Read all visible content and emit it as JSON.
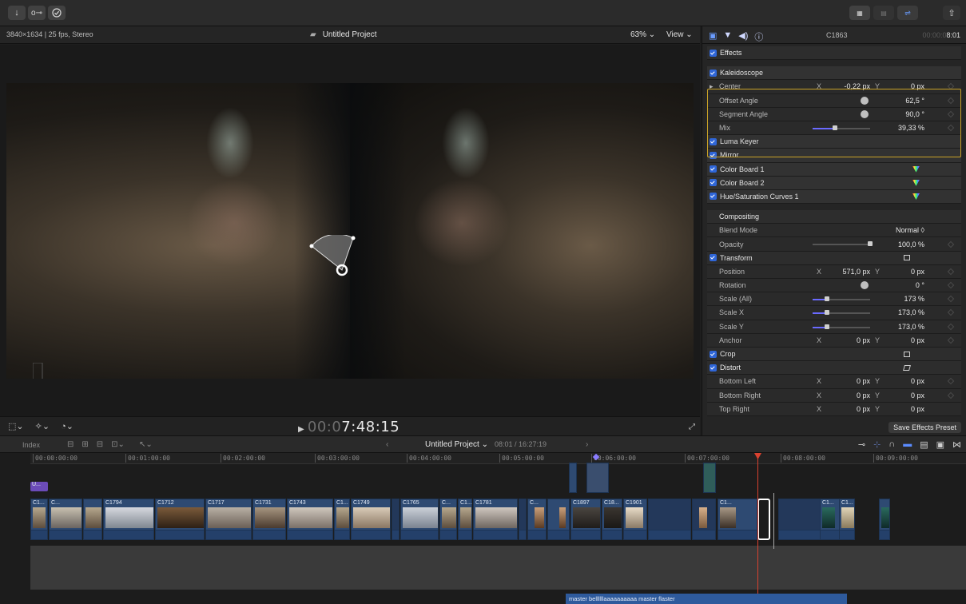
{
  "toolbar": {
    "import_icon": "download-arrow-icon",
    "keywords_icon": "key-icon",
    "background_tasks_icon": "checkmark-circle-icon",
    "share_icon": "share-icon"
  },
  "viewer": {
    "format": "3840×1634 | 25 fps, Stereo",
    "project_title": "Untitled Project",
    "zoom": "63%",
    "zoom_arrow": "⌄",
    "view_label": "View",
    "view_arrow": "⌄",
    "timecode_dim": "00:0",
    "timecode_bright": "7:48:15"
  },
  "inspector": {
    "clip_name": "C1863",
    "timecode_dim": "00:00:0",
    "timecode_bright": "8:01",
    "effects_header": "Effects",
    "kaleidoscope": {
      "name": "Kaleidoscope",
      "center_label": "Center",
      "center_x": "-0,22 px",
      "center_y": "0 px",
      "offset_angle_label": "Offset Angle",
      "offset_angle": "62,5 °",
      "segment_angle_label": "Segment Angle",
      "segment_angle": "90,0 °",
      "mix_label": "Mix",
      "mix": "39,33 %",
      "mix_fraction": 0.3933
    },
    "effects": [
      "Luma Keyer",
      "Mirror",
      "Color Board 1",
      "Color Board 2",
      "Hue/Saturation Curves 1"
    ],
    "compositing": {
      "header": "Compositing",
      "blend_mode_label": "Blend Mode",
      "blend_mode": "Normal ◊",
      "opacity_label": "Opacity",
      "opacity": "100,0 %",
      "opacity_fraction": 1.0
    },
    "transform": {
      "header": "Transform",
      "position_label": "Position",
      "position_x": "571,0 px",
      "position_y": "0 px",
      "rotation_label": "Rotation",
      "rotation": "0 °",
      "scale_all_label": "Scale (All)",
      "scale_all": "173 %",
      "scale_x_label": "Scale X",
      "scale_x": "173,0 %",
      "scale_y_label": "Scale Y",
      "scale_y": "173,0 %",
      "anchor_label": "Anchor",
      "anchor_x": "0 px",
      "anchor_y": "0 px"
    },
    "crop_header": "Crop",
    "distort": {
      "header": "Distort",
      "bottom_left_label": "Bottom Left",
      "bottom_left_x": "0 px",
      "bottom_left_y": "0 px",
      "bottom_right_label": "Bottom Right",
      "bottom_right_x": "0 px",
      "bottom_right_y": "0 px",
      "top_right_label": "Top Right",
      "top_right_x": "0 px",
      "top_right_y": "0 px"
    },
    "x_label": "X",
    "y_label": "Y",
    "save_preset": "Save Effects Preset"
  },
  "timeline": {
    "index_label": "Index",
    "project_title": "Untitled Project",
    "title_arrow": "⌄",
    "duration": "08:01 / 16:27:19",
    "nav_back": "‹",
    "nav_forward": "›",
    "ruler": [
      "00:00:00:00",
      "00:01:00:00",
      "00:02:00:00",
      "00:03:00:00",
      "00:04:00:00",
      "00:05:00:00",
      "00:06:00:00",
      "00:07:00:00",
      "00:08:00:00",
      "00:09:00:00"
    ],
    "purple_clip_label": "U...",
    "clip_labels": [
      "C1...",
      "C...",
      "C1794",
      "C1712",
      "C1717",
      "C1731",
      "C1743",
      "C1...",
      "C1749",
      "C1765",
      "C...",
      "C1...",
      "C1781",
      "C...",
      "C1897",
      "C18...",
      "C1901",
      "C1...",
      "C1...",
      "C1..."
    ],
    "audio_label": "master bellllllaaaaaaaaaa master flaster"
  }
}
